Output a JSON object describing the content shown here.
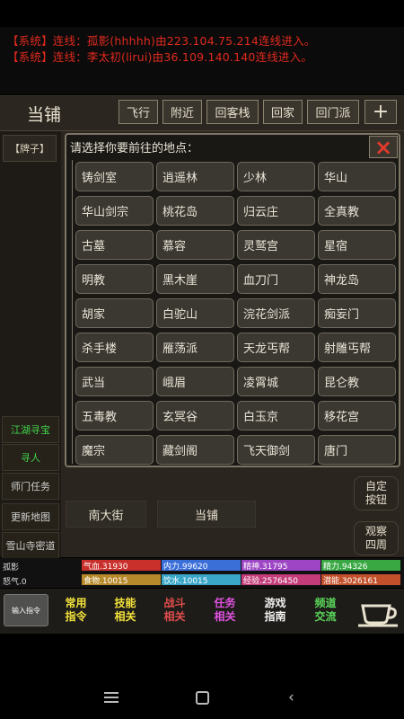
{
  "messages": [
    "【系统】连线：孤影(hhhhh)由223.104.75.214连线进入。",
    "【系统】连线：李太初(lirui)由36.109.140.140连线进入。"
  ],
  "header": {
    "title": "当铺",
    "buttons": [
      "飞行",
      "附近",
      "回客栈",
      "回家",
      "回门派"
    ],
    "plus": "+"
  },
  "left_tag": "【牌子】",
  "dialog": {
    "prompt": "请选择你要前往的地点：",
    "close": "×",
    "locations": [
      "铸剑室",
      "逍遥林",
      "少林",
      "华山",
      "华山剑宗",
      "桃花岛",
      "归云庄",
      "全真教",
      "古墓",
      "慕容",
      "灵鹫宫",
      "星宿",
      "明教",
      "黑木崖",
      "血刀门",
      "神龙岛",
      "胡家",
      "白驼山",
      "浣花剑派",
      "痴妄门",
      "杀手楼",
      "雁荡派",
      "天龙丐帮",
      "射雕丐帮",
      "武当",
      "峨眉",
      "凌霄城",
      "昆仑教",
      "五毒教",
      "玄冥谷",
      "白玉京",
      "移花宫",
      "魔宗",
      "藏剑阁",
      "飞天御剑",
      "唐门"
    ]
  },
  "side": [
    {
      "label": "江湖寻宝",
      "color": "#41d24a"
    },
    {
      "label": "寻人",
      "color": "#41d24a"
    },
    {
      "label": "师门任务",
      "color": "#cfcfcf"
    },
    {
      "label": "更新地图",
      "color": "#cfcfcf"
    },
    {
      "label": "雪山寺密道",
      "color": "#cfcfcf"
    }
  ],
  "exits": [
    "南大街",
    "当铺"
  ],
  "right_buttons": [
    "自定\n按钮",
    "观察\n四周"
  ],
  "stats": {
    "name": "孤影",
    "anger": "怒气.0",
    "row1": [
      {
        "label": "气血.31930",
        "color": "#c9302c"
      },
      {
        "label": "内力.99620",
        "color": "#3a6fd8"
      },
      {
        "label": "精神.31795",
        "color": "#9d45c4"
      },
      {
        "label": "精力.94326",
        "color": "#39a843"
      }
    ],
    "row2": [
      {
        "label": "食物.10015",
        "color": "#b6892a"
      },
      {
        "label": "饮水.10015",
        "color": "#3aa7c8"
      },
      {
        "label": "经验.2576450",
        "color": "#c43c7a"
      },
      {
        "label": "潜能.3026161",
        "color": "#c2502a"
      }
    ]
  },
  "bottom_nav": [
    {
      "label": "常用\n指令",
      "color": "#f2e23b"
    },
    {
      "label": "技能\n相关",
      "color": "#f2e23b"
    },
    {
      "label": "战斗\n相关",
      "color": "#e24d4d"
    },
    {
      "label": "任务\n相关",
      "color": "#e052e0"
    },
    {
      "label": "游戏\n指南",
      "color": "#f0f0f0"
    },
    {
      "label": "频道\n交流",
      "color": "#5bd85b"
    }
  ],
  "input_label": "输入指令"
}
